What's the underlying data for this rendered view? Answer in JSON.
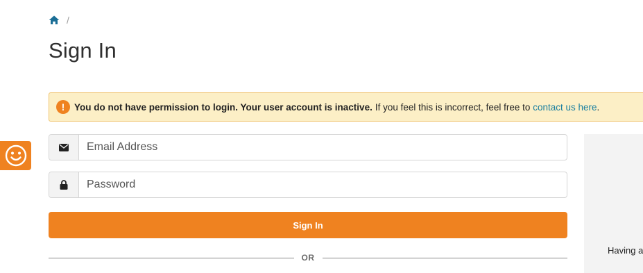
{
  "breadcrumb": {
    "home_icon": "home-icon",
    "separator": "/"
  },
  "page": {
    "title": "Sign In"
  },
  "alert": {
    "icon": "exclamation-icon",
    "bold_text": "You do not have permission to login. Your user account is inactive.",
    "text": "If you feel this is incorrect, feel free to",
    "link_text": "contact us here",
    "trailing": ".",
    "background_color": "#fcefc6",
    "border_color": "#f0c36d"
  },
  "feedback_tab": {
    "icon": "smiley-icon",
    "color": "#ef8220"
  },
  "form": {
    "email": {
      "icon": "envelope-icon",
      "placeholder": "Email Address",
      "value": ""
    },
    "password": {
      "icon": "lock-icon",
      "placeholder": "Password",
      "value": ""
    },
    "submit_label": "Sign In",
    "accent_color": "#ef8220"
  },
  "divider": {
    "label": "OR"
  },
  "side_panel": {
    "help_text": "Having a"
  },
  "colors": {
    "link": "#1a7fa0",
    "home_icon": "#1a6e96"
  }
}
